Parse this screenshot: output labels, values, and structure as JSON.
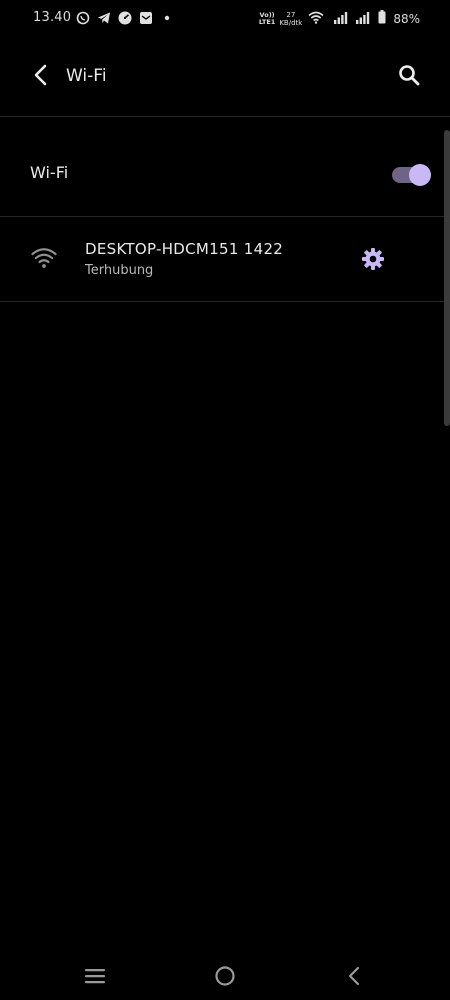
{
  "status_bar": {
    "time": "13.40",
    "notification_icons": [
      "whatsapp-icon",
      "telegram-icon",
      "speedometer-icon",
      "mail-icon",
      "dot-icon"
    ],
    "volte_line1": "Vo))",
    "volte_line2": "LTE1",
    "net_speed_value": "27",
    "net_speed_unit": "KB/dtk",
    "battery_percent": "88%"
  },
  "app_bar": {
    "title": "Wi-Fi"
  },
  "wifi_toggle": {
    "label": "Wi-Fi",
    "enabled": true
  },
  "network": {
    "name": "DESKTOP-HDCM151 1422",
    "status": "Terhubung"
  },
  "colors": {
    "background": "#000000",
    "accent": "#c9b8f5",
    "toggle_track": "#6e6486",
    "divider": "#262626"
  }
}
